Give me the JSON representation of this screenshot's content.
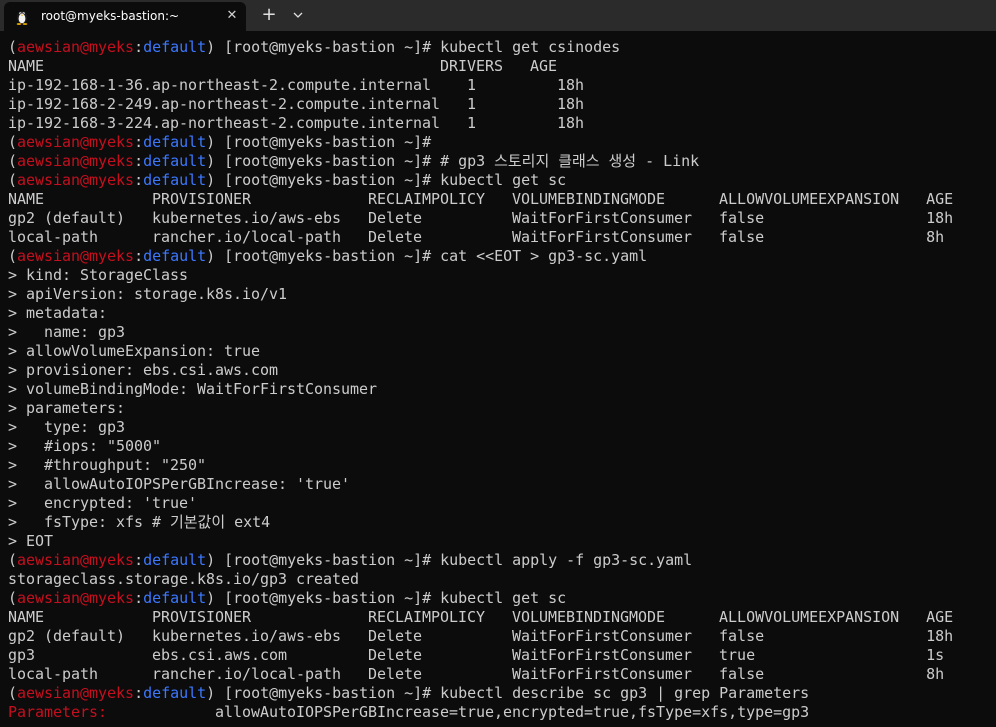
{
  "window": {
    "tab_title": "root@myeks-bastion:~",
    "close_glyph": "✕",
    "new_tab_glyph": "+",
    "dropdown_icon": "chevron-down-icon",
    "tab_icon": "linux-penguin-icon"
  },
  "colors": {
    "background": "#0c0c0c",
    "titlebar": "#2b2b2b",
    "prompt_user": "#c50f1f",
    "prompt_namespace": "#3b78ff",
    "text": "#cccccc"
  },
  "prompt": {
    "open": "(",
    "user": "aewsian",
    "at": "@",
    "host": "myeks",
    "colon": ":",
    "namespace": "default",
    "rest": ") [root@myeks-bastion ~]# "
  },
  "terminal_lines": [
    {
      "type": "prompt",
      "cmd": "kubectl get csinodes"
    },
    {
      "type": "out",
      "text": "NAME                                            DRIVERS   AGE"
    },
    {
      "type": "out",
      "text": "ip-192-168-1-36.ap-northeast-2.compute.internal    1         18h"
    },
    {
      "type": "out",
      "text": "ip-192-168-2-249.ap-northeast-2.compute.internal   1         18h"
    },
    {
      "type": "out",
      "text": "ip-192-168-3-224.ap-northeast-2.compute.internal   1         18h"
    },
    {
      "type": "prompt",
      "cmd": ""
    },
    {
      "type": "prompt",
      "cmd": "# gp3 스토리지 클래스 생성 - Link"
    },
    {
      "type": "prompt",
      "cmd": "kubectl get sc"
    },
    {
      "type": "out",
      "text": "NAME            PROVISIONER             RECLAIMPOLICY   VOLUMEBINDINGMODE      ALLOWVOLUMEEXPANSION   AGE"
    },
    {
      "type": "out",
      "text": "gp2 (default)   kubernetes.io/aws-ebs   Delete          WaitForFirstConsumer   false                  18h"
    },
    {
      "type": "out",
      "text": "local-path      rancher.io/local-path   Delete          WaitForFirstConsumer   false                  8h"
    },
    {
      "type": "prompt",
      "cmd": "cat <<EOT > gp3-sc.yaml"
    },
    {
      "type": "out",
      "text": "> kind: StorageClass"
    },
    {
      "type": "out",
      "text": "> apiVersion: storage.k8s.io/v1"
    },
    {
      "type": "out",
      "text": "> metadata:"
    },
    {
      "type": "out",
      "text": ">   name: gp3"
    },
    {
      "type": "out",
      "text": "> allowVolumeExpansion: true"
    },
    {
      "type": "out",
      "text": "> provisioner: ebs.csi.aws.com"
    },
    {
      "type": "out",
      "text": "> volumeBindingMode: WaitForFirstConsumer"
    },
    {
      "type": "out",
      "text": "> parameters:"
    },
    {
      "type": "out",
      "text": ">   type: gp3"
    },
    {
      "type": "out",
      "text": ">   #iops: \"5000\""
    },
    {
      "type": "out",
      "text": ">   #throughput: \"250\""
    },
    {
      "type": "out",
      "text": ">   allowAutoIOPSPerGBIncrease: 'true'"
    },
    {
      "type": "out",
      "text": ">   encrypted: 'true'"
    },
    {
      "type": "out",
      "text": ">   fsType: xfs # 기본값이 ext4"
    },
    {
      "type": "out",
      "text": "> EOT"
    },
    {
      "type": "prompt",
      "cmd": "kubectl apply -f gp3-sc.yaml"
    },
    {
      "type": "out",
      "text": "storageclass.storage.k8s.io/gp3 created"
    },
    {
      "type": "prompt",
      "cmd": "kubectl get sc"
    },
    {
      "type": "out",
      "text": "NAME            PROVISIONER             RECLAIMPOLICY   VOLUMEBINDINGMODE      ALLOWVOLUMEEXPANSION   AGE"
    },
    {
      "type": "out",
      "text": "gp2 (default)   kubernetes.io/aws-ebs   Delete          WaitForFirstConsumer   false                  18h"
    },
    {
      "type": "out",
      "text": "gp3             ebs.csi.aws.com         Delete          WaitForFirstConsumer   true                   1s"
    },
    {
      "type": "out",
      "text": "local-path      rancher.io/local-path   Delete          WaitForFirstConsumer   false                  8h"
    },
    {
      "type": "prompt",
      "cmd": "kubectl describe sc gp3 | grep Parameters"
    },
    {
      "type": "match",
      "label": "Parameters:",
      "text": "            allowAutoIOPSPerGBIncrease=true,encrypted=true,fsType=xfs,type=gp3"
    }
  ]
}
